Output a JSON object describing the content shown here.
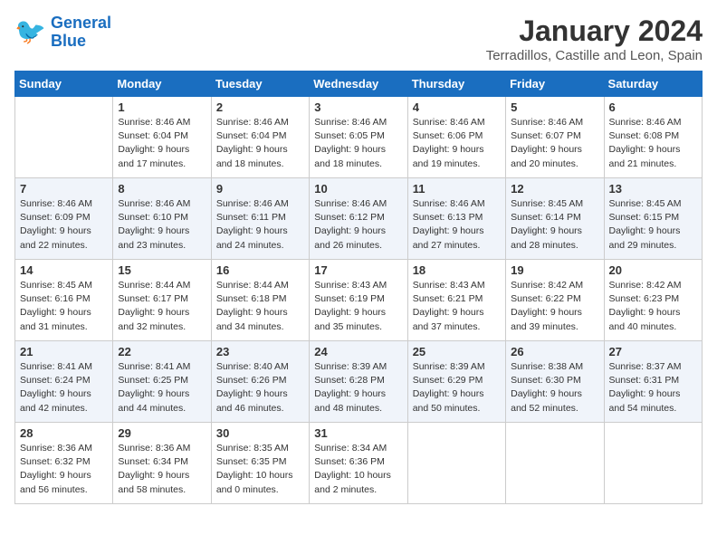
{
  "header": {
    "logo_line1": "General",
    "logo_line2": "Blue",
    "month": "January 2024",
    "location": "Terradillos, Castille and Leon, Spain"
  },
  "weekdays": [
    "Sunday",
    "Monday",
    "Tuesday",
    "Wednesday",
    "Thursday",
    "Friday",
    "Saturday"
  ],
  "weeks": [
    [
      {
        "day": "",
        "info": ""
      },
      {
        "day": "1",
        "info": "Sunrise: 8:46 AM\nSunset: 6:04 PM\nDaylight: 9 hours\nand 17 minutes."
      },
      {
        "day": "2",
        "info": "Sunrise: 8:46 AM\nSunset: 6:04 PM\nDaylight: 9 hours\nand 18 minutes."
      },
      {
        "day": "3",
        "info": "Sunrise: 8:46 AM\nSunset: 6:05 PM\nDaylight: 9 hours\nand 18 minutes."
      },
      {
        "day": "4",
        "info": "Sunrise: 8:46 AM\nSunset: 6:06 PM\nDaylight: 9 hours\nand 19 minutes."
      },
      {
        "day": "5",
        "info": "Sunrise: 8:46 AM\nSunset: 6:07 PM\nDaylight: 9 hours\nand 20 minutes."
      },
      {
        "day": "6",
        "info": "Sunrise: 8:46 AM\nSunset: 6:08 PM\nDaylight: 9 hours\nand 21 minutes."
      }
    ],
    [
      {
        "day": "7",
        "info": "Sunrise: 8:46 AM\nSunset: 6:09 PM\nDaylight: 9 hours\nand 22 minutes."
      },
      {
        "day": "8",
        "info": "Sunrise: 8:46 AM\nSunset: 6:10 PM\nDaylight: 9 hours\nand 23 minutes."
      },
      {
        "day": "9",
        "info": "Sunrise: 8:46 AM\nSunset: 6:11 PM\nDaylight: 9 hours\nand 24 minutes."
      },
      {
        "day": "10",
        "info": "Sunrise: 8:46 AM\nSunset: 6:12 PM\nDaylight: 9 hours\nand 26 minutes."
      },
      {
        "day": "11",
        "info": "Sunrise: 8:46 AM\nSunset: 6:13 PM\nDaylight: 9 hours\nand 27 minutes."
      },
      {
        "day": "12",
        "info": "Sunrise: 8:45 AM\nSunset: 6:14 PM\nDaylight: 9 hours\nand 28 minutes."
      },
      {
        "day": "13",
        "info": "Sunrise: 8:45 AM\nSunset: 6:15 PM\nDaylight: 9 hours\nand 29 minutes."
      }
    ],
    [
      {
        "day": "14",
        "info": "Sunrise: 8:45 AM\nSunset: 6:16 PM\nDaylight: 9 hours\nand 31 minutes."
      },
      {
        "day": "15",
        "info": "Sunrise: 8:44 AM\nSunset: 6:17 PM\nDaylight: 9 hours\nand 32 minutes."
      },
      {
        "day": "16",
        "info": "Sunrise: 8:44 AM\nSunset: 6:18 PM\nDaylight: 9 hours\nand 34 minutes."
      },
      {
        "day": "17",
        "info": "Sunrise: 8:43 AM\nSunset: 6:19 PM\nDaylight: 9 hours\nand 35 minutes."
      },
      {
        "day": "18",
        "info": "Sunrise: 8:43 AM\nSunset: 6:21 PM\nDaylight: 9 hours\nand 37 minutes."
      },
      {
        "day": "19",
        "info": "Sunrise: 8:42 AM\nSunset: 6:22 PM\nDaylight: 9 hours\nand 39 minutes."
      },
      {
        "day": "20",
        "info": "Sunrise: 8:42 AM\nSunset: 6:23 PM\nDaylight: 9 hours\nand 40 minutes."
      }
    ],
    [
      {
        "day": "21",
        "info": "Sunrise: 8:41 AM\nSunset: 6:24 PM\nDaylight: 9 hours\nand 42 minutes."
      },
      {
        "day": "22",
        "info": "Sunrise: 8:41 AM\nSunset: 6:25 PM\nDaylight: 9 hours\nand 44 minutes."
      },
      {
        "day": "23",
        "info": "Sunrise: 8:40 AM\nSunset: 6:26 PM\nDaylight: 9 hours\nand 46 minutes."
      },
      {
        "day": "24",
        "info": "Sunrise: 8:39 AM\nSunset: 6:28 PM\nDaylight: 9 hours\nand 48 minutes."
      },
      {
        "day": "25",
        "info": "Sunrise: 8:39 AM\nSunset: 6:29 PM\nDaylight: 9 hours\nand 50 minutes."
      },
      {
        "day": "26",
        "info": "Sunrise: 8:38 AM\nSunset: 6:30 PM\nDaylight: 9 hours\nand 52 minutes."
      },
      {
        "day": "27",
        "info": "Sunrise: 8:37 AM\nSunset: 6:31 PM\nDaylight: 9 hours\nand 54 minutes."
      }
    ],
    [
      {
        "day": "28",
        "info": "Sunrise: 8:36 AM\nSunset: 6:32 PM\nDaylight: 9 hours\nand 56 minutes."
      },
      {
        "day": "29",
        "info": "Sunrise: 8:36 AM\nSunset: 6:34 PM\nDaylight: 9 hours\nand 58 minutes."
      },
      {
        "day": "30",
        "info": "Sunrise: 8:35 AM\nSunset: 6:35 PM\nDaylight: 10 hours\nand 0 minutes."
      },
      {
        "day": "31",
        "info": "Sunrise: 8:34 AM\nSunset: 6:36 PM\nDaylight: 10 hours\nand 2 minutes."
      },
      {
        "day": "",
        "info": ""
      },
      {
        "day": "",
        "info": ""
      },
      {
        "day": "",
        "info": ""
      }
    ]
  ]
}
